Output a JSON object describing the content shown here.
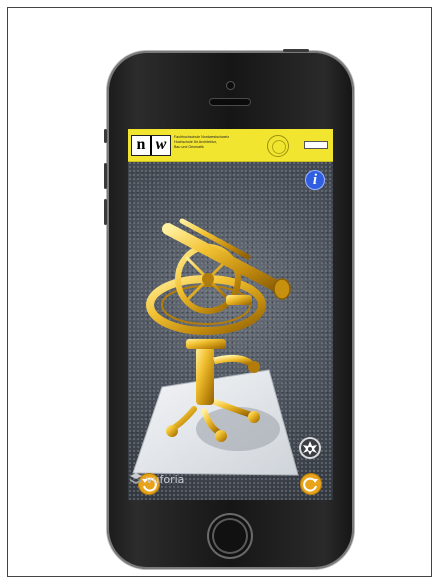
{
  "ar_app": {
    "banner": {
      "logo_letters": [
        "n",
        "w"
      ],
      "institution_lines": [
        "Fachhochschule Nordwestschweiz",
        "Hochschule für Architektur,",
        "Bau und Geomatik"
      ]
    },
    "info_button": {
      "icon": "info-icon",
      "label": "i"
    },
    "rotate_left_button": {
      "icon": "rotate-left-icon"
    },
    "rotate_right_button": {
      "icon": "rotate-right-icon"
    },
    "flash_button": {
      "icon": "flash-icon"
    },
    "powered_by": {
      "label": "vuforia",
      "icon": "vuforia-logo-icon"
    },
    "colors": {
      "banner": "#f1e52f",
      "info_button": "#2f5ee0",
      "rotate_buttons": "#e8a31a",
      "model_gold": "#d4a017"
    }
  }
}
